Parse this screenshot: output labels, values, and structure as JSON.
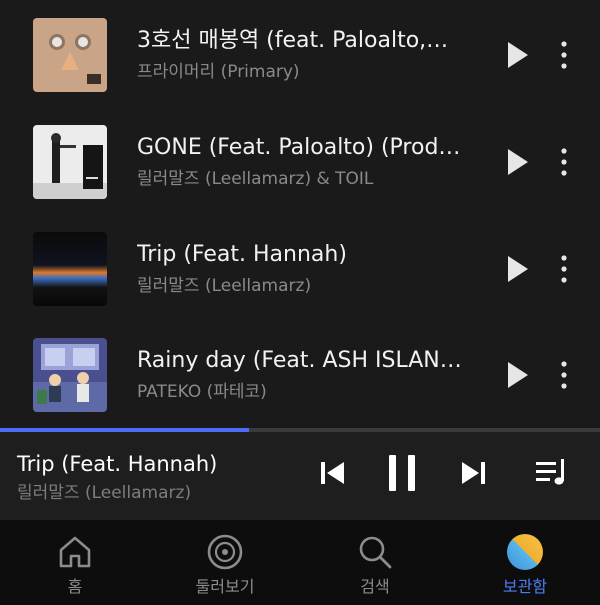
{
  "tracks": [
    {
      "title": "3호선 매봉역 (feat. Paloalto,…",
      "artist": "프라이머리 (Primary)",
      "art_icon": "album-art-primary"
    },
    {
      "title": "GONE (Feat. Paloalto) (Prod…",
      "artist": "릴러말즈 (Leellamarz) & TOIL",
      "art_icon": "album-art-gone"
    },
    {
      "title": "Trip (Feat. Hannah)",
      "artist": "릴러말즈 (Leellamarz)",
      "art_icon": "album-art-trip"
    },
    {
      "title": "Rainy day (Feat. ASH ISLAN…",
      "artist": "PATEKO (파테코)",
      "art_icon": "album-art-rainy-day"
    }
  ],
  "playback": {
    "progress": 0.415,
    "accent_color": "#4a6cf7"
  },
  "now_playing": {
    "title": "Trip (Feat. Hannah)",
    "artist": "릴러말즈 (Leellamarz)"
  },
  "controls": [
    "previous-icon",
    "pause-icon",
    "next-icon",
    "playlist-icon"
  ],
  "tabs": [
    {
      "label": "홈",
      "icon": "home-icon",
      "active": false
    },
    {
      "label": "둘러보기",
      "icon": "browse-disc-icon",
      "active": false
    },
    {
      "label": "검색",
      "icon": "search-icon",
      "active": false
    },
    {
      "label": "보관함",
      "icon": "library-avatar-icon",
      "active": true
    }
  ]
}
